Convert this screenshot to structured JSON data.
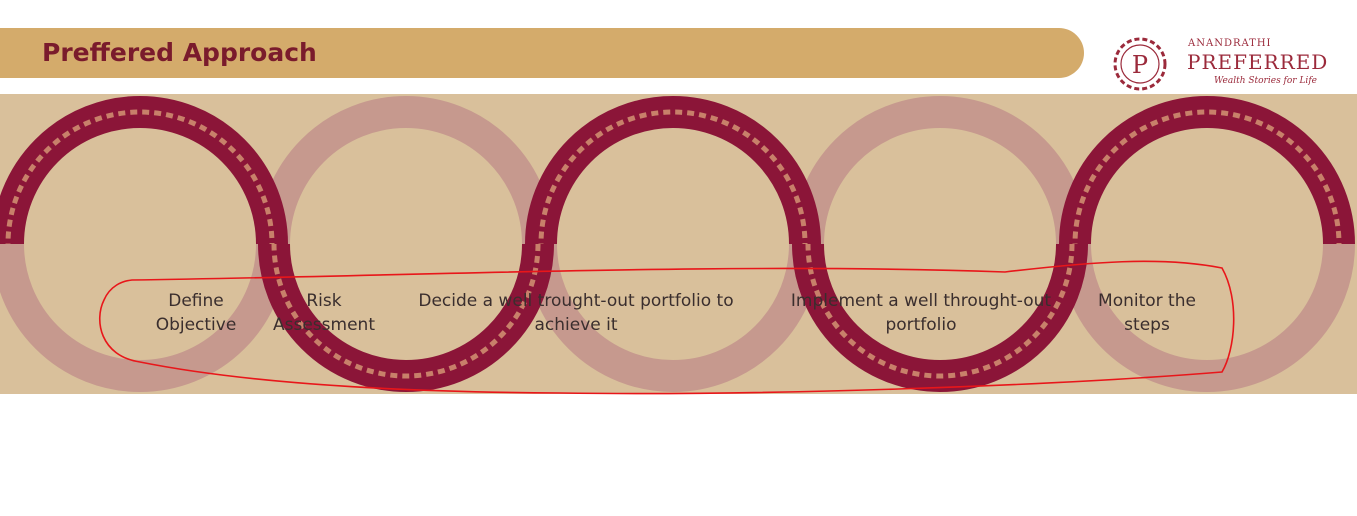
{
  "header": {
    "title": "Preffered Approach"
  },
  "logo": {
    "monogram": "P",
    "brand": "ANANDRATHI",
    "name": "PREFERRED",
    "tagline": "Wealth Stories for Life"
  },
  "steps": [
    {
      "label": "Define\nObjective"
    },
    {
      "label": "Risk\nAssessment"
    },
    {
      "label": "Decide a well trought-out portfolio to\nachieve it"
    },
    {
      "label": "Implement a well throught-out\nportfolio"
    },
    {
      "label": "Monitor the\nsteps"
    }
  ],
  "colors": {
    "accent": "#d4ab6b",
    "maroon": "#8b1538",
    "pink": "#c6998e",
    "band": "#d9c09b",
    "annotation": "#e8161a"
  }
}
